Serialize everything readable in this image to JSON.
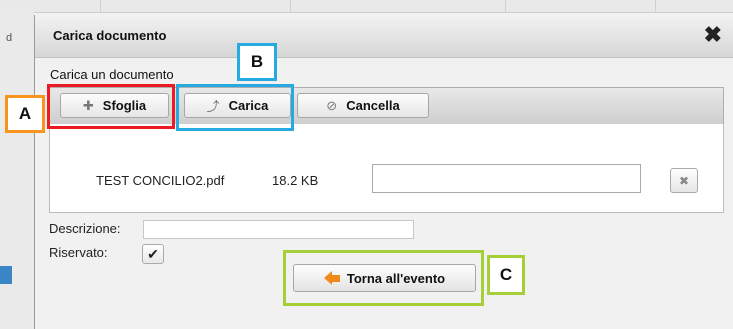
{
  "background": {
    "header_fragment": "d"
  },
  "dialog": {
    "title": "Carica documento",
    "close_glyph": "✖",
    "upload_label": "Carica un documento",
    "toolbar": {
      "browse": {
        "label": "Sfoglia",
        "icon": "plus-icon",
        "glyph": "✚"
      },
      "upload": {
        "label": "Carica",
        "icon": "upload-arrow-icon",
        "glyph": "⤴"
      },
      "cancel": {
        "label": "Cancella",
        "icon": "cancel-icon",
        "glyph": "⊘"
      }
    },
    "file": {
      "name": "TEST CONCILIO2.pdf",
      "size": "18.2 KB",
      "title_value": "",
      "remove_glyph": "✖"
    },
    "description_label": "Descrizione:",
    "description_value": "",
    "reserved_label": "Riservato:",
    "reserved_checked": true,
    "check_glyph": "✔",
    "back_button": "Torna all'evento"
  },
  "annotations": [
    {
      "letter": "A",
      "color": "#f7941d",
      "target": "Sfoglia"
    },
    {
      "letter": "B",
      "color": "#27aae1",
      "target": "Carica"
    },
    {
      "letter": "C",
      "color": "#a6ce39",
      "target": "Torna all'evento"
    },
    {
      "highlight_color": "#ed1c24",
      "target": "Sfoglia"
    }
  ],
  "colors": {
    "back_arrow": "#f08a1d",
    "page_accent": "#3b86c6"
  }
}
